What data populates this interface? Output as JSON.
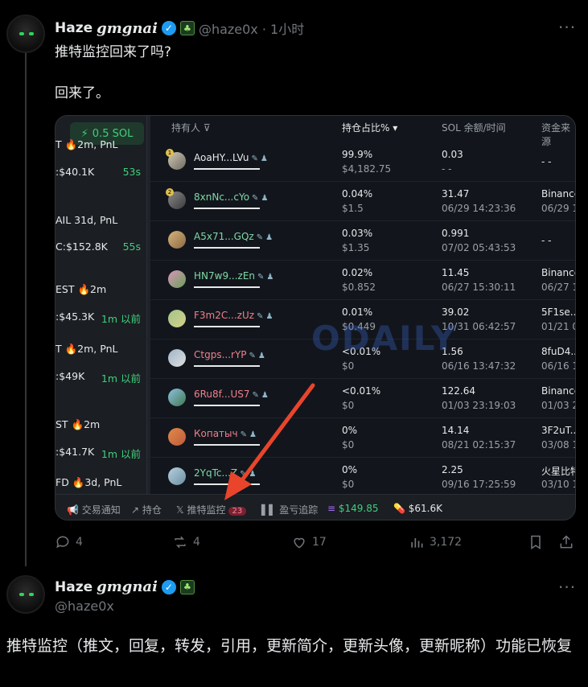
{
  "tweet1": {
    "name": "Haze",
    "name_script": "gmgnai",
    "handle_time": "@haze0x · 1小时",
    "text_line1": "推特监控回来了吗?",
    "text_line2": "回来了。",
    "actions": {
      "replies": "4",
      "retweets": "4",
      "likes": "17",
      "views": "3,172"
    }
  },
  "tweet2": {
    "name": "Haze",
    "name_script": "gmgnai",
    "handle": "@haze0x",
    "text": "推特监控（推文，回复，转发，引用，更新简介，更新头像，更新昵称）功能已恢复"
  },
  "image": {
    "top_button": "0.5 SOL",
    "left_rows": [
      {
        "a": "T 🔥2m, PnL",
        "b": ":$40.1K",
        "t": "53s"
      },
      {
        "a": "AIL 31d, PnL",
        "b": "C:$152.8K",
        "t": "55s"
      },
      {
        "a": "EST 🔥2m",
        "b": ":$45.3K",
        "t": "1m 以前"
      },
      {
        "a": "T 🔥2m, PnL",
        "b": ":$49K",
        "t": "1m 以前"
      },
      {
        "a": "ST 🔥2m",
        "b": ":$41.7K",
        "t": "1m 以前"
      },
      {
        "a": "FD 🔥3d, PnL",
        "b": "",
        "t": ""
      }
    ],
    "headers": {
      "holder": "持有人",
      "pct": "持仓占比% ▾",
      "sol": "SOL 余额/时间",
      "source": "资金来源"
    },
    "rows": [
      {
        "holder": "AoaHY...LVu",
        "pct": "99.9%",
        "usd": "$4,182.75",
        "sol": "0.03",
        "time": "- -",
        "src1": "- -",
        "src2": ""
      },
      {
        "holder": "8xnNc...cYo",
        "pct": "0.04%",
        "usd": "$1.5",
        "sol": "31.47",
        "time": "06/29 14:23:36",
        "src1": "Binance",
        "src2": "06/29 1"
      },
      {
        "holder": "A5x71...GQz",
        "pct": "0.03%",
        "usd": "$1.35",
        "sol": "0.991",
        "time": "07/02 05:43:53",
        "src1": "- -",
        "src2": ""
      },
      {
        "holder": "HN7w9...zEn",
        "pct": "0.02%",
        "usd": "$0.852",
        "sol": "11.45",
        "time": "06/27 15:30:11",
        "src1": "Binance",
        "src2": "06/27 1"
      },
      {
        "holder": "F3m2C...zUz",
        "pct": "0.01%",
        "usd": "$0.449",
        "sol": "39.02",
        "time": "10/31 06:42:57",
        "src1": "5F1se..",
        "src2": "01/21 0"
      },
      {
        "holder": "Ctgps...rYP",
        "pct": "<0.01%",
        "usd": "$0",
        "sol": "1.56",
        "time": "06/16 13:47:32",
        "src1": "8fuD4..",
        "src2": "06/16 1"
      },
      {
        "holder": "6Ru8f...US7",
        "pct": "<0.01%",
        "usd": "$0",
        "sol": "122.64",
        "time": "01/03 23:19:03",
        "src1": "Binance",
        "src2": "01/03 2"
      },
      {
        "holder": "Копатыч",
        "pct": "0%",
        "usd": "$0",
        "sol": "14.14",
        "time": "08/21 02:15:37",
        "src1": "3F2uT..",
        "src2": "03/08 1"
      },
      {
        "holder": "2YqTc...Z",
        "pct": "0%",
        "usd": "$0",
        "sol": "2.25",
        "time": "09/16 17:25:59",
        "src1": "火星比特",
        "src2": "03/10 1"
      }
    ],
    "bottom": {
      "notify": "交易通知",
      "holdings": "持仓",
      "twitter": "推特监控",
      "twitter_badge": "23",
      "pnl": "盈亏追踪",
      "sol_val": "$149.85",
      "pill_val": "$61.6K"
    },
    "watermark": "ODAILY"
  },
  "colors": {
    "verified": "#1d9bf0",
    "accent_green": "#3fcf7c",
    "arrow": "#e8452c"
  }
}
